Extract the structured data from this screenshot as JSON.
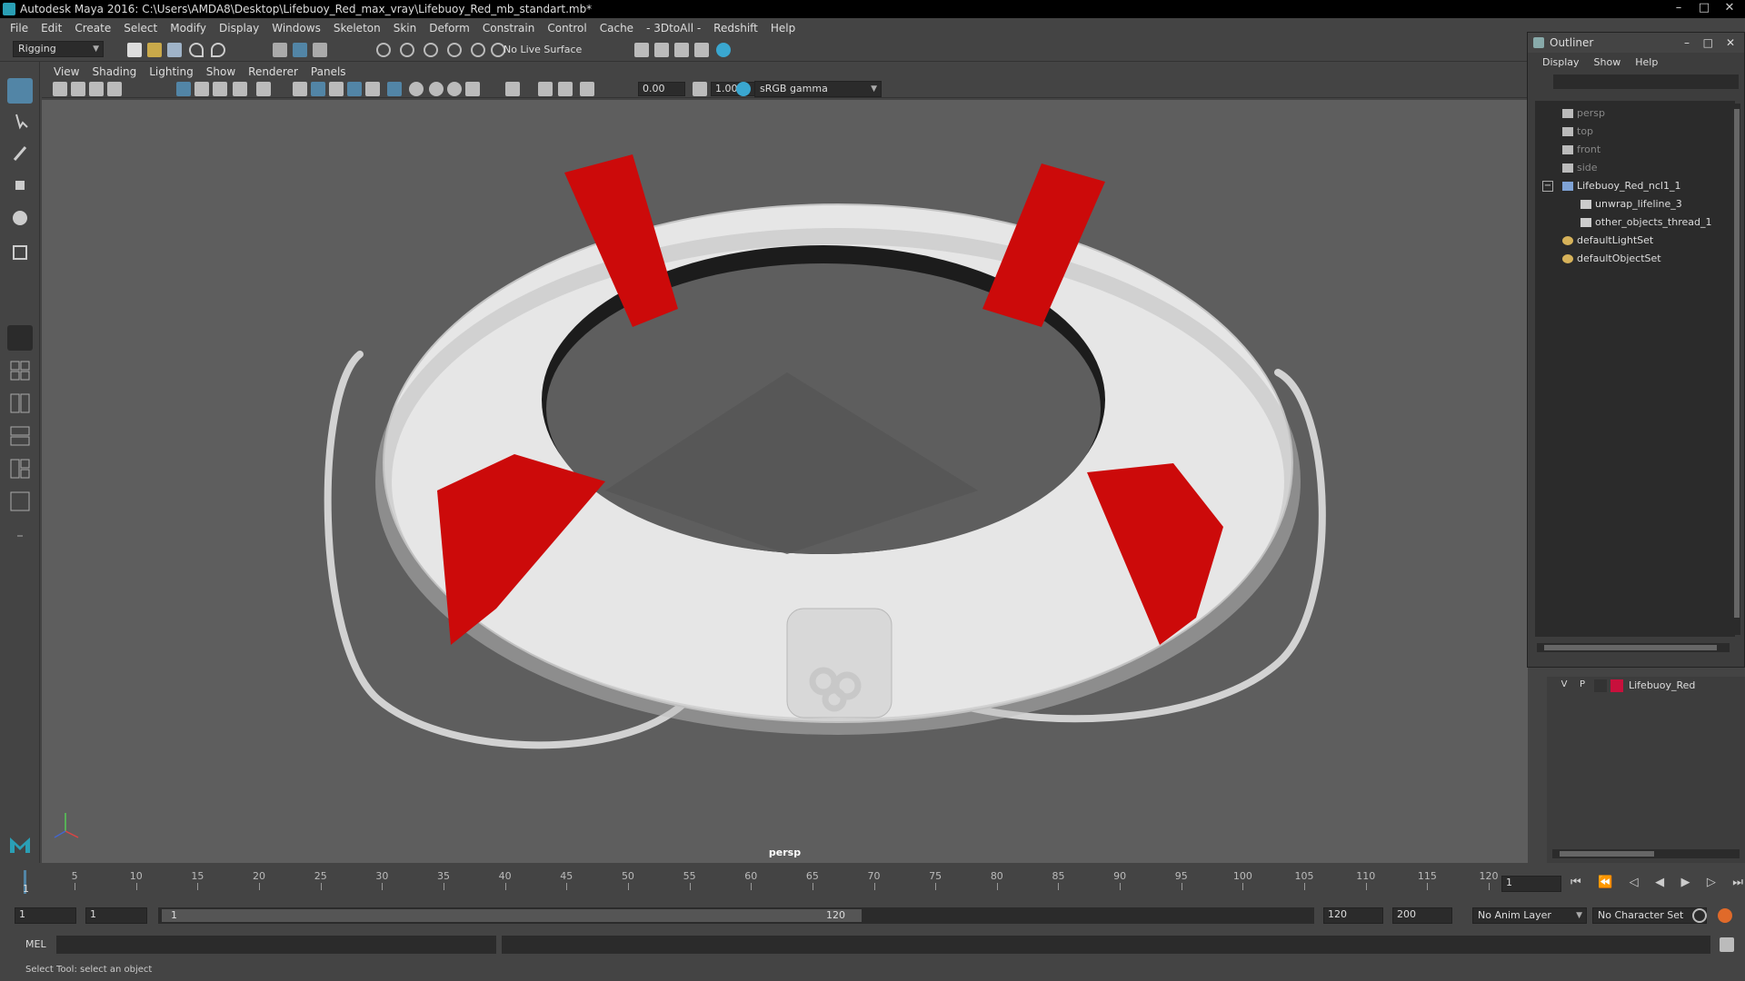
{
  "window": {
    "title": "Autodesk Maya 2016: C:\\Users\\AMDA8\\Desktop\\Lifebuoy_Red_max_vray\\Lifebuoy_Red_mb_standart.mb*",
    "min": "–",
    "max": "□",
    "close": "✕"
  },
  "menubar": [
    "File",
    "Edit",
    "Create",
    "Select",
    "Modify",
    "Display",
    "Windows",
    "Skeleton",
    "Skin",
    "Deform",
    "Constrain",
    "Control",
    "Cache",
    "- 3DtoAll -",
    "Redshift",
    "Help"
  ],
  "shelf": {
    "menuset": "Rigging",
    "live_surface": "No Live Surface"
  },
  "panel": {
    "menus": [
      "View",
      "Shading",
      "Lighting",
      "Show",
      "Renderer",
      "Panels"
    ],
    "exposure": "0.00",
    "gamma": "1.00",
    "color_space": "sRGB gamma",
    "camera": "persp"
  },
  "outliner": {
    "title": "Outliner",
    "menus": [
      "Display",
      "Show",
      "Help"
    ],
    "items": [
      {
        "label": "persp",
        "indent": 1,
        "icon": "camera-icon",
        "dim": true
      },
      {
        "label": "top",
        "indent": 1,
        "icon": "camera-icon",
        "dim": true
      },
      {
        "label": "front",
        "indent": 1,
        "icon": "camera-icon",
        "dim": true
      },
      {
        "label": "side",
        "indent": 1,
        "icon": "camera-icon",
        "dim": true
      },
      {
        "label": "Lifebuoy_Red_ncl1_1",
        "indent": 1,
        "icon": "group-icon",
        "dim": false,
        "expander": "−"
      },
      {
        "label": "unwrap_lifeline_3",
        "indent": 2,
        "icon": "mesh-icon",
        "dim": false
      },
      {
        "label": "other_objects_thread_1",
        "indent": 2,
        "icon": "mesh-icon",
        "dim": false
      },
      {
        "label": "defaultLightSet",
        "indent": 1,
        "icon": "set-icon",
        "dim": false
      },
      {
        "label": "defaultObjectSet",
        "indent": 1,
        "icon": "set-icon",
        "dim": false
      }
    ]
  },
  "layers": {
    "visible": "V",
    "playback": "P",
    "name": "Lifebuoy_Red",
    "color": "#c8103c"
  },
  "timeline": {
    "ticks": [
      5,
      10,
      15,
      20,
      25,
      30,
      35,
      40,
      45,
      50,
      55,
      60,
      65,
      70,
      75,
      80,
      85,
      90,
      95,
      100,
      105,
      110,
      115,
      120
    ],
    "current_frame": "1",
    "start_marker": "1"
  },
  "range": {
    "start": "1",
    "playback_start": "1",
    "slider_start": "1",
    "slider_end": "120",
    "playback_end": "120",
    "end": "200",
    "anim_layer": "No Anim Layer",
    "character_set": "No Character Set"
  },
  "cmdline": {
    "language": "MEL"
  },
  "helpline": {
    "text": "Select Tool: select an object"
  },
  "colors": {
    "buoy_white": "#e6e6e6",
    "buoy_red": "#cc0a0a",
    "viewport_bg": "#5e5e5e",
    "accent": "#5285a6"
  }
}
